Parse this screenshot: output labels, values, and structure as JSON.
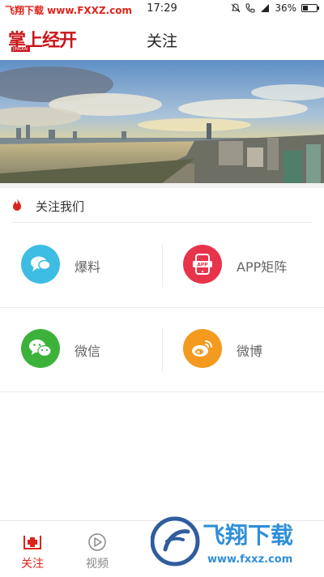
{
  "status_bar": {
    "watermark": "飞翔下载 www.FXXZ.com",
    "time": "17:29",
    "battery": "36%"
  },
  "header": {
    "logo_text": "掌上经开",
    "logo_sub": "JINGKAI",
    "title": "关注"
  },
  "section": {
    "title": "关注我们"
  },
  "grid": {
    "items": [
      {
        "label": "爆料",
        "icon": "chat-bubble-icon",
        "color": "#3dbde3"
      },
      {
        "label": "APP矩阵",
        "icon": "app-phone-icon",
        "color": "#e8344a"
      },
      {
        "label": "微信",
        "icon": "wechat-icon",
        "color": "#3db23b"
      },
      {
        "label": "微博",
        "icon": "weibo-icon",
        "color": "#f39a1f"
      }
    ]
  },
  "bottom_nav": {
    "items": [
      {
        "label": "关注",
        "icon": "medical-cross-icon",
        "active": true
      },
      {
        "label": "视频",
        "icon": "play-circle-icon",
        "active": false
      }
    ]
  },
  "watermark_logo": {
    "brand": "飞翔下载",
    "url": "www.fxxz.com"
  },
  "colors": {
    "accent": "#d9251d",
    "logo_red": "#c9161c"
  }
}
